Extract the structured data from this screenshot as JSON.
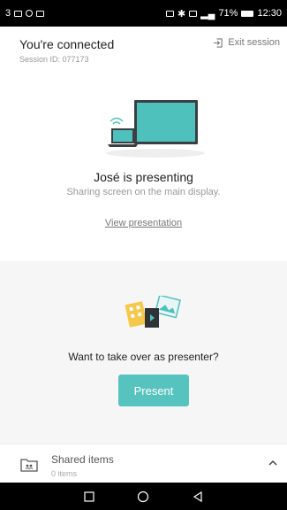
{
  "status_bar": {
    "left_text": "3",
    "battery": "71%",
    "time": "12:30"
  },
  "header": {
    "title": "You're connected",
    "session_id": "Session ID: 077173",
    "exit_label": "Exit session"
  },
  "presenting": {
    "name_line": "José is presenting",
    "subtitle": "Sharing screen on the main display.",
    "view_link": "View presentation"
  },
  "takeover": {
    "question": "Want to take over as presenter?",
    "present_label": "Present"
  },
  "shared_items": {
    "label": "Shared items",
    "count": "0 items"
  },
  "colors": {
    "accent": "#56c3bf",
    "panel_bg": "#f6f6f6"
  },
  "icons": [
    "wifi-icon",
    "laptop-icon",
    "monitor-icon",
    "exit-icon",
    "images-icon",
    "folder-icon",
    "chevron-up-icon",
    "nav-square-icon",
    "nav-circle-icon",
    "nav-back-icon"
  ]
}
